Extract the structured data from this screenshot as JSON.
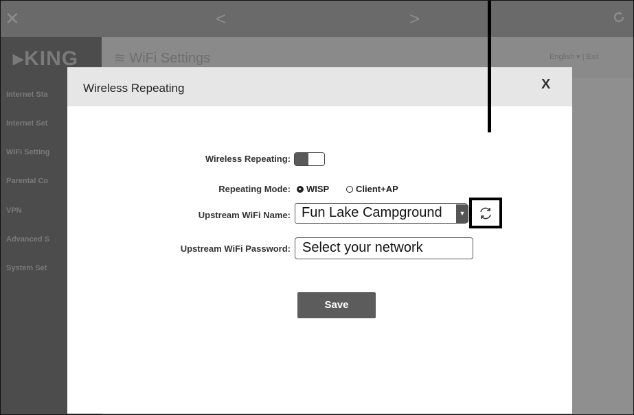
{
  "topbar": {
    "close_glyph": "✕",
    "back_glyph": "<",
    "forward_glyph": ">",
    "reload_icon": "refresh-icon"
  },
  "sidebar": {
    "logo": "KING",
    "items": [
      {
        "label": "Internet Sta"
      },
      {
        "label": "Internet Set"
      },
      {
        "label": "WiFi Setting"
      },
      {
        "label": "Parental Co"
      },
      {
        "label": "VPN"
      },
      {
        "label": "Advanced S"
      },
      {
        "label": "System Set"
      }
    ]
  },
  "header": {
    "title": "WiFi Settings",
    "language": "English",
    "exit": "Exit"
  },
  "modal": {
    "title": "Wireless Repeating",
    "close_label": "X",
    "fields": {
      "repeating_label": "Wireless Repeating:",
      "mode_label": "Repeating Mode:",
      "mode_options": [
        "WISP",
        "Client+AP"
      ],
      "mode_selected": "WISP",
      "upstream_name_label": "Upstream WiFi Name:",
      "upstream_name_value": "Fun Lake Campground",
      "upstream_password_label": "Upstream WiFi Password:",
      "upstream_password_value": "Select your network"
    },
    "save_label": "Save"
  },
  "colors": {
    "sidebar_bg": "#4c4c4c",
    "button_bg": "#5c5c5c",
    "modal_header_bg": "#e6e6e6"
  }
}
